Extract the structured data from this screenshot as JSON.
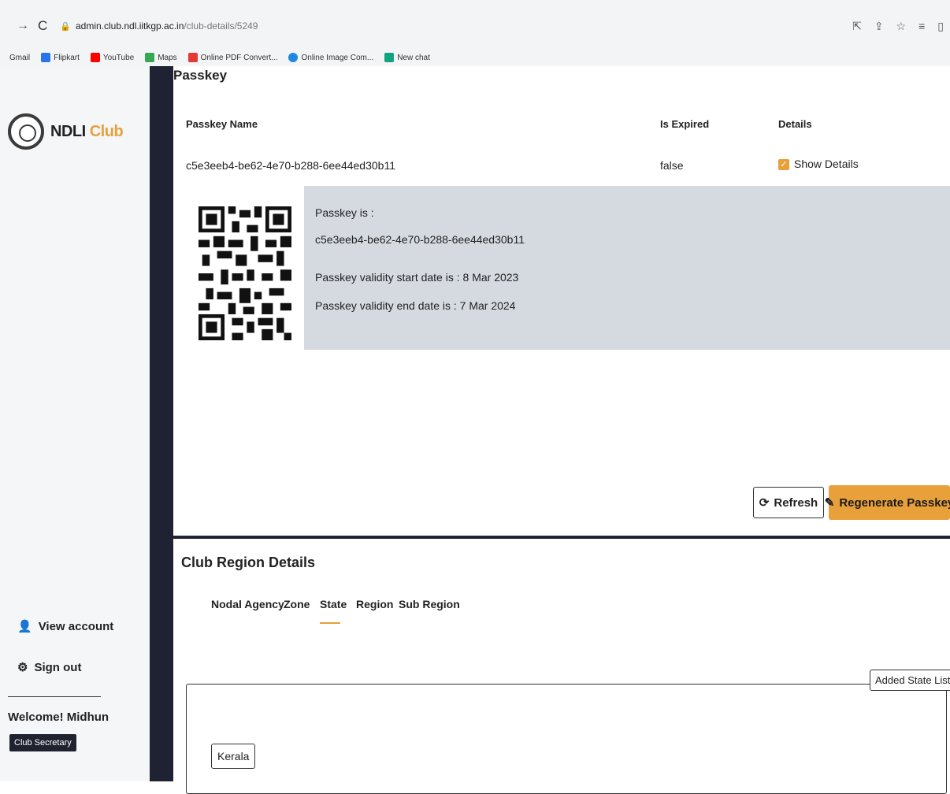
{
  "browser": {
    "url_host": "admin.club.ndl.iitkgp.ac.in",
    "url_path": "/club-details/5249",
    "bookmarks": [
      {
        "label": "Gmail",
        "color": "#ffffff"
      },
      {
        "label": "Flipkart",
        "color": "#2874f0"
      },
      {
        "label": "YouTube",
        "color": "#ff0000"
      },
      {
        "label": "Maps",
        "color": "#34a853"
      },
      {
        "label": "Online PDF Convert...",
        "color": "#e53935"
      },
      {
        "label": "Online Image Com...",
        "color": "#1e88e5"
      },
      {
        "label": "New chat",
        "color": "#10a37f"
      }
    ]
  },
  "sidebar": {
    "brand_prefix": "NDLI",
    "brand_suffix": "Club",
    "view_account": "View account",
    "sign_out": "Sign out",
    "welcome": "Welcome! Midhun",
    "role": "Club Secretary"
  },
  "passkey": {
    "section_title": "Passkey",
    "col_name": "Passkey Name",
    "col_expired": "Is Expired",
    "col_details": "Details",
    "row": {
      "name": "c5e3eeb4-be62-4e70-b288-6ee44ed30b11",
      "expired": "false",
      "details_link": "Show Details"
    },
    "detail": {
      "label": "Passkey is :",
      "value": "c5e3eeb4-be62-4e70-b288-6ee44ed30b11",
      "start": "Passkey validity start date is : 8 Mar 2023",
      "end": "Passkey validity end date is : 7 Mar 2024"
    },
    "refresh_label": "Refresh",
    "regenerate_label": "Regenerate Passkey"
  },
  "region": {
    "title": "Club Region Details",
    "tabs": [
      "Nodal Agency",
      "Zone",
      "State",
      "Region",
      "Sub Region"
    ],
    "active_tab": "State",
    "list_title": "Added State List",
    "states": [
      "Kerala"
    ]
  },
  "colors": {
    "accent": "#e8a03b",
    "dark": "#1e2233",
    "panel": "#d5dae1"
  }
}
